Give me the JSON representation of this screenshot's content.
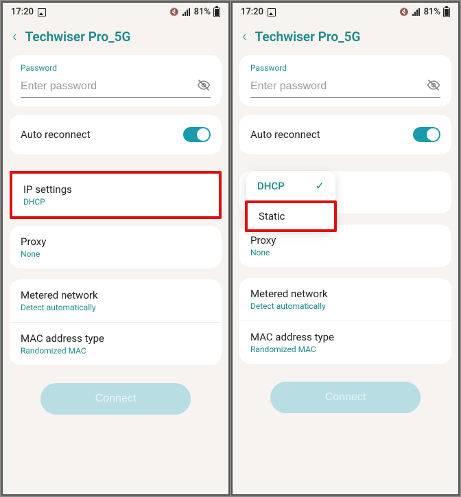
{
  "status": {
    "time": "17:20",
    "battery_text": "81%"
  },
  "header": {
    "title": "Techwiser Pro_5G"
  },
  "password": {
    "label": "Password",
    "placeholder": "Enter password"
  },
  "auto_reconnect": {
    "label": "Auto reconnect",
    "on": true
  },
  "ip_settings": {
    "title": "IP settings",
    "value": "DHCP"
  },
  "proxy": {
    "title": "Proxy",
    "value": "None"
  },
  "metered": {
    "title": "Metered network",
    "value": "Detect automatically"
  },
  "mac": {
    "title": "MAC address type",
    "value": "Randomized MAC"
  },
  "connect": {
    "label": "Connect"
  },
  "dropdown": {
    "selected": "DHCP",
    "other": "Static"
  }
}
